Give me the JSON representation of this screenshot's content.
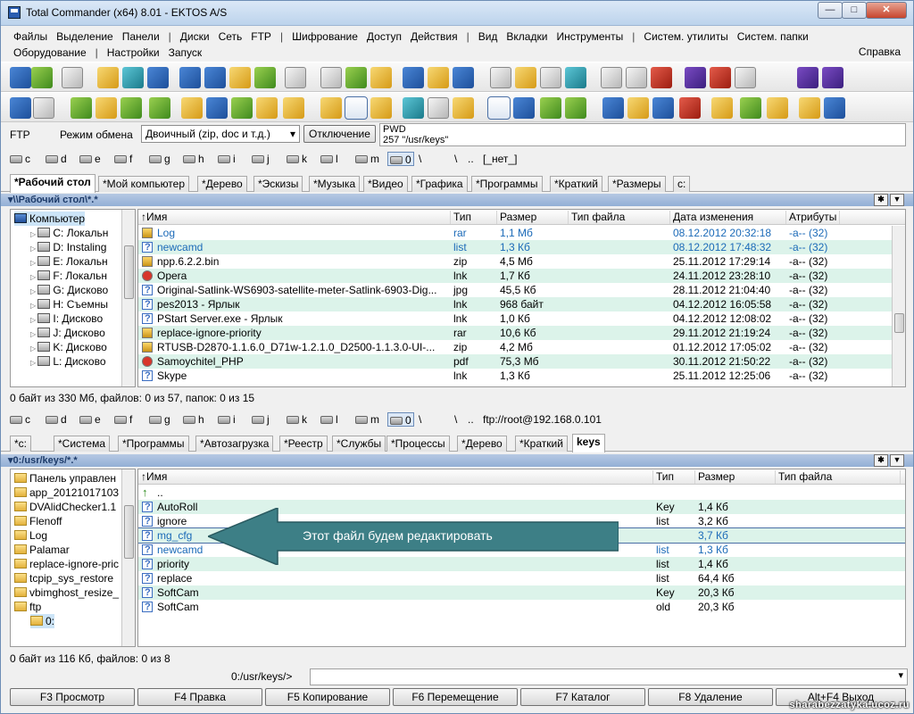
{
  "window": {
    "title": "Total Commander (x64) 8.01 - EKTOS A/S",
    "min": "—",
    "max": "□",
    "close": "✕"
  },
  "menu": {
    "row1": [
      "Файлы",
      "Выделение",
      "Панели",
      "|",
      "Диски",
      "Сеть",
      "FTP",
      "|",
      "Шифрование",
      "Доступ",
      "Действия",
      "|",
      "Вид",
      "Вкладки",
      "Инструменты",
      "|",
      "Систем. утилиты",
      "Систем. папки"
    ],
    "row2": [
      "Оборудование",
      "|",
      "Настройки",
      "Запуск"
    ],
    "help": "Справка"
  },
  "ftp": {
    "label": "FTP",
    "mode_label": "Режим обмена",
    "mode_value": "Двоичный (zip, doc и т.д.)",
    "disconnect": "Отключение",
    "log_line1": "PWD",
    "log_line2": "257 \"/usr/keys\""
  },
  "drives_top": {
    "items": [
      "c",
      "d",
      "e",
      "f",
      "g",
      "h",
      "i",
      "j",
      "k",
      "l",
      "m",
      "0",
      "\\",
      "\\",
      ".."
    ],
    "none_label": "[_нет_]"
  },
  "drives_bottom": {
    "items": [
      "c",
      "d",
      "e",
      "f",
      "g",
      "h",
      "i",
      "j",
      "k",
      "l",
      "m",
      "0",
      "\\",
      "\\",
      ".."
    ],
    "ftp_path": "ftp://root@192.168.0.101"
  },
  "tabs_top": [
    "*Рабочий стол",
    "*Мой компьютер",
    "*Дерево",
    "*Эскизы",
    "*Музыка",
    "*Видео",
    "*Графика",
    "*Программы",
    "*Краткий",
    "*Размеры",
    "c:"
  ],
  "tabs_bottom": [
    "*c:",
    "*Система",
    "*Программы",
    "*Автозагрузка",
    "*Реестр",
    "*Службы",
    "*Процессы",
    "*Дерево",
    "*Краткий",
    "keys"
  ],
  "left": {
    "path": "▾\\\\Рабочий стол\\*.*",
    "tree": [
      {
        "label": "Компьютер",
        "icon": "computer-icon",
        "indent": 0,
        "sel": true
      },
      {
        "label": "C:  Локальн",
        "icon": "drive-icon",
        "indent": 1
      },
      {
        "label": "D:  Instaling",
        "icon": "drive-icon",
        "indent": 1
      },
      {
        "label": "E:  Локальн",
        "icon": "drive-icon",
        "indent": 1
      },
      {
        "label": "F:  Локальн",
        "icon": "drive-icon",
        "indent": 1
      },
      {
        "label": "G:  Дисково",
        "icon": "drive-icon",
        "indent": 1
      },
      {
        "label": "H:  Съемны",
        "icon": "drive-icon",
        "indent": 1
      },
      {
        "label": "I:  Дисково",
        "icon": "drive-icon",
        "indent": 1
      },
      {
        "label": "J:  Дисково",
        "icon": "drive-icon",
        "indent": 1
      },
      {
        "label": "K:  Дисково",
        "icon": "drive-icon",
        "indent": 1
      },
      {
        "label": "L:  Дисково",
        "icon": "drive-icon",
        "indent": 1
      }
    ],
    "columns": [
      "↑Имя",
      "Тип",
      "Размер",
      "Тип файла",
      "Дата изменения",
      "Атрибуты"
    ],
    "files": [
      {
        "name": "Log",
        "ext": "rar",
        "size": "1,1 Мб",
        "date": "08.12.2012 20:32:18",
        "attr": "-a-- (32)",
        "icon": "z",
        "hl": true
      },
      {
        "name": "newcamd",
        "ext": "list",
        "size": "1,3 Кб",
        "date": "08.12.2012 17:48:32",
        "attr": "-a-- (32)",
        "icon": "q",
        "hl": true
      },
      {
        "name": "npp.6.2.2.bin",
        "ext": "zip",
        "size": "4,5 Мб",
        "date": "25.11.2012 17:29:14",
        "attr": "-a-- (32)",
        "icon": "z"
      },
      {
        "name": "Opera",
        "ext": "lnk",
        "size": "1,7 Кб",
        "date": "24.11.2012 23:28:10",
        "attr": "-a-- (32)",
        "icon": "r"
      },
      {
        "name": "Original-Satlink-WS6903-satellite-meter-Satlink-6903-Dig...",
        "ext": "jpg",
        "size": "45,5 Кб",
        "date": "28.11.2012 21:04:40",
        "attr": "-a-- (32)",
        "icon": "q"
      },
      {
        "name": "pes2013 - Ярлык",
        "ext": "lnk",
        "size": "968 байт",
        "date": "04.12.2012 16:05:58",
        "attr": "-a-- (32)",
        "icon": "q"
      },
      {
        "name": "PStart Server.exe - Ярлык",
        "ext": "lnk",
        "size": "1,0 Кб",
        "date": "04.12.2012 12:08:02",
        "attr": "-a-- (32)",
        "icon": "q"
      },
      {
        "name": "replace-ignore-priority",
        "ext": "rar",
        "size": "10,6 Кб",
        "date": "29.11.2012 21:19:24",
        "attr": "-a-- (32)",
        "icon": "z"
      },
      {
        "name": "RTUSB-D2870-1.1.6.0_D71w-1.2.1.0_D2500-1.1.3.0-UI-...",
        "ext": "zip",
        "size": "4,2 Мб",
        "date": "01.12.2012 17:05:02",
        "attr": "-a-- (32)",
        "icon": "z"
      },
      {
        "name": "Samoychitel_PHP",
        "ext": "pdf",
        "size": "75,3 Мб",
        "date": "30.11.2012 21:50:22",
        "attr": "-a-- (32)",
        "icon": "r"
      },
      {
        "name": "Skype",
        "ext": "lnk",
        "size": "1,3 Кб",
        "date": "25.11.2012 12:25:06",
        "attr": "-a-- (32)",
        "icon": "q"
      }
    ],
    "status": "0 байт из 330 Мб, файлов: 0 из 57, папок: 0 из 15"
  },
  "right": {
    "path": "▾0:/usr/keys/*.*",
    "tree": [
      {
        "label": "Панель управлен",
        "icon": "folder-icon",
        "indent": 0
      },
      {
        "label": "app_20121017103",
        "icon": "folder-icon",
        "indent": 0
      },
      {
        "label": "DVAlidChecker1.1",
        "icon": "folder-icon",
        "indent": 0
      },
      {
        "label": "Flenoff",
        "icon": "folder-icon",
        "indent": 0
      },
      {
        "label": "Log",
        "icon": "folder-icon",
        "indent": 0
      },
      {
        "label": "Palamar",
        "icon": "folder-icon",
        "indent": 0
      },
      {
        "label": "replace-ignore-pric",
        "icon": "folder-icon",
        "indent": 0
      },
      {
        "label": "tcpip_sys_restore",
        "icon": "folder-icon",
        "indent": 0
      },
      {
        "label": "vbimghost_resize_",
        "icon": "folder-icon",
        "indent": 0
      },
      {
        "label": "ftp",
        "icon": "folder-icon",
        "indent": 0
      },
      {
        "label": "0:",
        "icon": "folder-icon",
        "indent": 1,
        "sel": true
      }
    ],
    "columns": [
      "↑Имя",
      "Тип",
      "Размер",
      "Тип файла"
    ],
    "files": [
      {
        "name": "..",
        "ext": "",
        "size": "",
        "icon": "u"
      },
      {
        "name": "AutoRoll",
        "ext": "Key",
        "size": "1,4 Кб",
        "icon": "q"
      },
      {
        "name": "ignore",
        "ext": "list",
        "size": "3,2 Кб",
        "icon": "q"
      },
      {
        "name": "mg_cfg",
        "ext": "",
        "size": "3,7 Кб",
        "icon": "q",
        "hl": true,
        "sel": true
      },
      {
        "name": "newcamd",
        "ext": "list",
        "size": "1,3 Кб",
        "icon": "q",
        "hl": true
      },
      {
        "name": "priority",
        "ext": "list",
        "size": "1,4 Кб",
        "icon": "q"
      },
      {
        "name": "replace",
        "ext": "list",
        "size": "64,4 Кб",
        "icon": "q"
      },
      {
        "name": "SoftCam",
        "ext": "Key",
        "size": "20,3 Кб",
        "icon": "q"
      },
      {
        "name": "SoftCam",
        "ext": "old",
        "size": "20,3 Кб",
        "icon": "q"
      }
    ],
    "status": "0 байт из 116 Кб, файлов: 0 из 8"
  },
  "annotation": "Этот файл будем редактировать",
  "cmdline_label": "0:/usr/keys/>",
  "fkeys": [
    "F3 Просмотр",
    "F4 Правка",
    "F5 Копирование",
    "F6 Перемещение",
    "F7 Каталог",
    "F8 Удаление",
    "Alt+F4 Выход"
  ],
  "watermark": "sharabezzatyka.ucoz.ru",
  "colors": {
    "accent": "#1b6ab8",
    "row_alt": "#dcf3ea",
    "arrow": "#3d7f86"
  }
}
